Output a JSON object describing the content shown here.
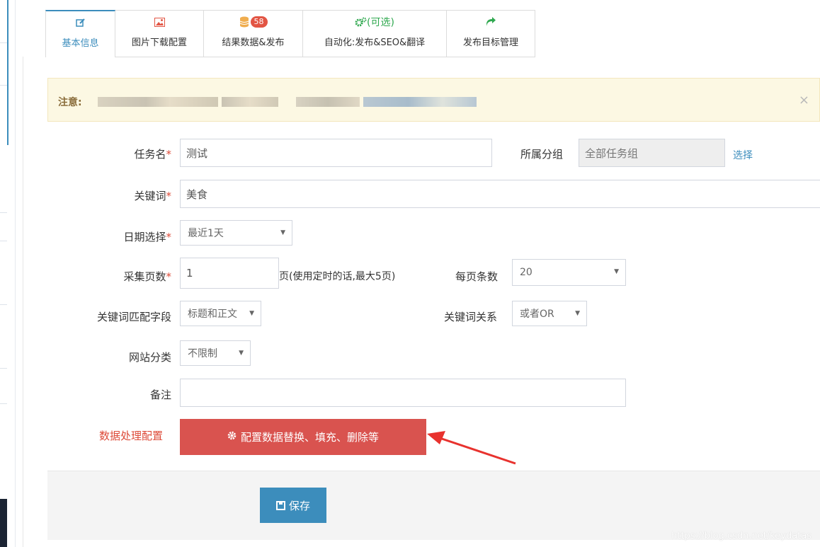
{
  "tabs": [
    {
      "label": "基本信息",
      "icon": "edit-icon"
    },
    {
      "label": "图片下载配置",
      "icon": "image-icon"
    },
    {
      "label": "结果数据&发布",
      "icon": "database-icon",
      "badge": "58"
    },
    {
      "label": "自动化:发布&SEO&翻译",
      "icon": "cogs-icon",
      "top_text": "(可选)"
    },
    {
      "label": "发布目标管理",
      "icon": "share-icon"
    }
  ],
  "notice": {
    "label": "注意:",
    "close_icon": "×"
  },
  "form": {
    "task_name_label": "任务名",
    "task_name_value": "测试",
    "group_label": "所属分组",
    "group_value": "全部任务组",
    "group_select_link": "选择",
    "keyword_label": "关键词",
    "keyword_value": "美食",
    "date_label": "日期选择",
    "date_value": "最近1天",
    "pages_label": "采集页数",
    "pages_value": "1",
    "pages_hint": "页(使用定时的话,最大5页)",
    "per_page_label": "每页条数",
    "per_page_value": "20",
    "match_field_label": "关键词匹配字段",
    "match_field_value": "标题和正文",
    "relation_label": "关键词关系",
    "relation_value": "或者OR",
    "category_label": "网站分类",
    "category_value": "不限制",
    "remark_label": "备注",
    "remark_value": "",
    "required_mark": "*",
    "caret": "▼",
    "data_config_label": "数据处理配置",
    "data_config_button": "配置数据替换、填充、删除等"
  },
  "footer": {
    "save_button": "保存"
  },
  "watermark": "https://blog.csdn.net/keydatas",
  "colors": {
    "primary": "#3c8dbc",
    "danger": "#d9534f",
    "warning_bg": "#fcf8e3",
    "success": "#2fa84f"
  }
}
